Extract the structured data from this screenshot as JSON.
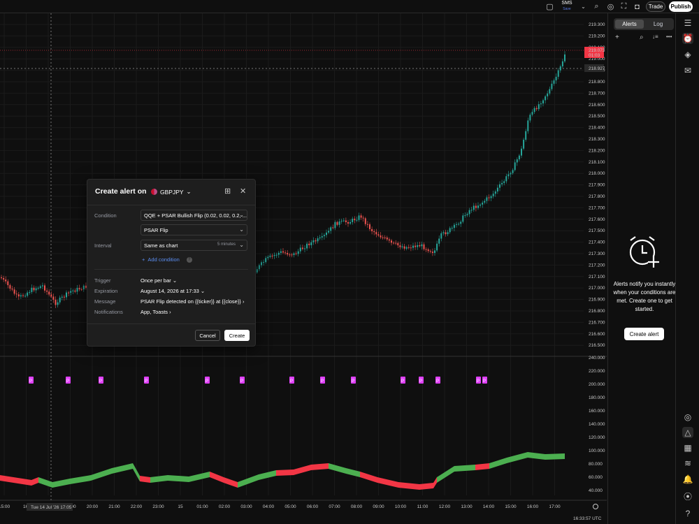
{
  "topbar": {
    "sms_label": "SMS",
    "sms_sub": "Save",
    "trade_label": "Trade",
    "publish_label": "Publish"
  },
  "chart": {
    "price_axis": [
      "219.300",
      "219.200",
      "219.100",
      "219.000",
      "218.900",
      "218.800",
      "218.700",
      "218.600",
      "218.500",
      "218.400",
      "218.300",
      "218.200",
      "218.100",
      "218.000",
      "217.900",
      "217.800",
      "217.700",
      "217.600",
      "217.500",
      "217.400",
      "217.300",
      "217.200",
      "217.100",
      "217.000",
      "216.900",
      "216.800",
      "216.700",
      "216.600",
      "216.500"
    ],
    "last_price": "219.073",
    "countdown": "01:03",
    "crosshair_price": "218.927",
    "indicator_axis": [
      "240.000",
      "220.000",
      "200.000",
      "180.000",
      "160.000",
      "140.000",
      "120.000",
      "100.000",
      "80.000",
      "60.000",
      "40.000"
    ],
    "time_axis": [
      "15:00",
      "16:",
      "18:00",
      "19:00",
      "20:00",
      "21:00",
      "22:00",
      "23:00",
      "15",
      "01:00",
      "02:00",
      "03:00",
      "04:00",
      "05:00",
      "06:00",
      "07:00",
      "08:00",
      "09:00",
      "10:00",
      "11:00",
      "12:00",
      "13:00",
      "14:00",
      "15:00",
      "16:00",
      "17:00"
    ],
    "crosshair_time": "Tue 14 Jul '26   17:05",
    "clock": "16:33:57 UTC",
    "marker_label": "P",
    "colors": {
      "up": "#26a69a",
      "down": "#ef5350",
      "green": "#4caf50",
      "red": "#f23645",
      "marker": "#e040fb",
      "last_price_bg": "#f23645"
    }
  },
  "dialog": {
    "title": "Create alert on",
    "symbol": "GBPJPY",
    "condition_label": "Condition",
    "condition_value": "QQE + PSAR Bullish Flip (0.02, 0.02, 0.2, ...",
    "condition_sub": "PSAR Flip",
    "interval_label": "Interval",
    "interval_value": "Same as chart",
    "interval_hint": "5 minutes",
    "add_condition": "Add condition",
    "trigger_label": "Trigger",
    "trigger_value": "Once per bar",
    "expiration_label": "Expiration",
    "expiration_value": "August 14, 2026 at 17:33",
    "message_label": "Message",
    "message_value": "PSAR Flip detected on {{ticker}} at {{close}}",
    "notifications_label": "Notifications",
    "notifications_value": "App, Toasts",
    "cancel_label": "Cancel",
    "create_label": "Create"
  },
  "alerts_panel": {
    "tabs": [
      "Alerts",
      "Log"
    ],
    "empty_text": "Alerts notify you instantly when your conditions are met. Create one to get started.",
    "create_label": "Create alert"
  }
}
